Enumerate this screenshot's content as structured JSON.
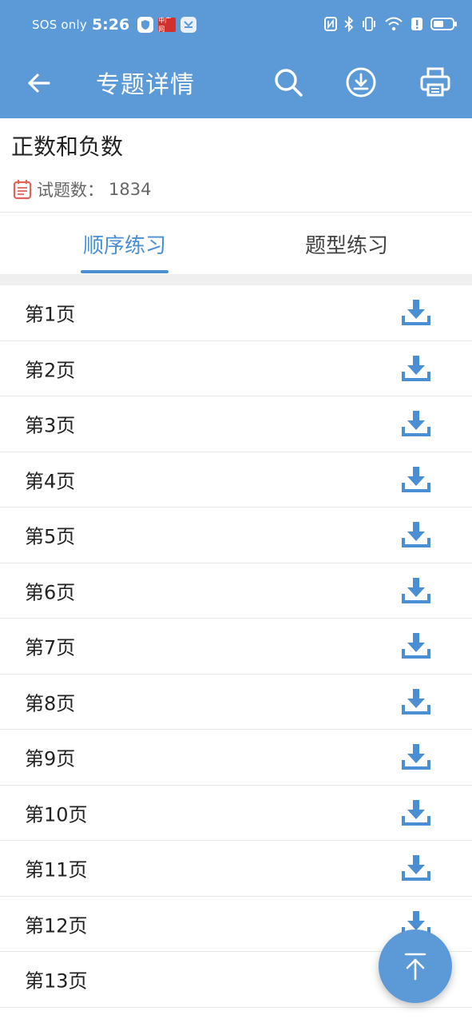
{
  "status_bar": {
    "sos": "SOS only",
    "time": "5:26",
    "news_badge": "中广网"
  },
  "nav": {
    "title": "专题详情",
    "icons": [
      "back-arrow-icon",
      "search-icon",
      "download-circle-icon",
      "printer-icon"
    ]
  },
  "topic": {
    "title": "正数和负数",
    "count_label": "试题数：",
    "count": "1834"
  },
  "tabs": [
    {
      "label": "顺序练习",
      "active": true
    },
    {
      "label": "题型练习",
      "active": false
    }
  ],
  "pages": [
    "第1页",
    "第2页",
    "第3页",
    "第4页",
    "第5页",
    "第6页",
    "第7页",
    "第8页",
    "第9页",
    "第10页",
    "第11页",
    "第12页",
    "第13页"
  ],
  "colors": {
    "header": "#5b9ad6",
    "accent": "#4a8fd3",
    "meta_icon": "#e0645a"
  }
}
